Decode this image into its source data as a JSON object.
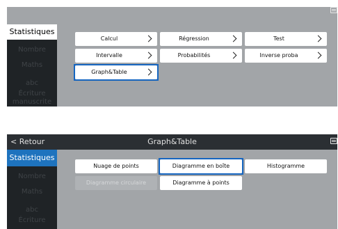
{
  "panel1": {
    "sidebar": [
      "Statistiques",
      "Nombre",
      "Maths",
      "abc",
      "Écriture manuscrite"
    ],
    "buttons": [
      {
        "label": "Calcul",
        "key": "calcul"
      },
      {
        "label": "Régression",
        "key": "regression"
      },
      {
        "label": "Test",
        "key": "test"
      },
      {
        "label": "Intervalle",
        "key": "intervalle"
      },
      {
        "label": "Probabilités",
        "key": "probabilites"
      },
      {
        "label": "Inverse proba",
        "key": "inverse-proba"
      },
      {
        "label": "Graph&Table",
        "key": "graph-table"
      }
    ],
    "selected": "Graph&Table"
  },
  "panel2": {
    "back": "< Retour",
    "title": "Graph&Table",
    "sidebar": [
      "Statistiques",
      "Nombre",
      "Maths",
      "abc",
      "Écriture"
    ],
    "buttons": [
      {
        "label": "Nuage de points",
        "key": "nuage-de-points",
        "enabled": true
      },
      {
        "label": "Diagramme en boîte",
        "key": "diagramme-en-boite",
        "enabled": true
      },
      {
        "label": "Histogramme",
        "key": "histogramme",
        "enabled": true
      },
      {
        "label": "Diagramme circulaire",
        "key": "diagramme-circulaire",
        "enabled": false
      },
      {
        "label": "Diagramme à points",
        "key": "diagramme-a-points",
        "enabled": true
      }
    ],
    "selected": "Diagramme en boîte"
  },
  "icons": {
    "keyboard": "keyboard-icon"
  },
  "colors": {
    "highlight": "#1565c0",
    "active_tab": "#1e73be",
    "sidebar_bg": "#1f2326",
    "panel_bg": "#a2a5a8"
  }
}
